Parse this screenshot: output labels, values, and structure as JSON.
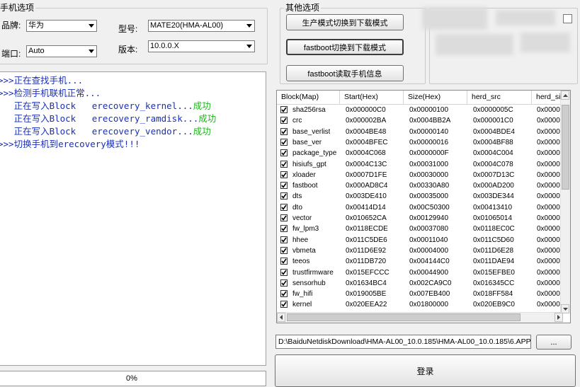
{
  "phone_options": {
    "title": "手机选项",
    "brand_label": "品牌:",
    "brand_value": "华为",
    "model_label": "型号:",
    "model_value": "MATE20(HMA-AL00)",
    "port_label": "端口:",
    "port_value": "Auto",
    "version_label": "版本:",
    "version_value": "10.0.0.X"
  },
  "other_options": {
    "title": "其他选项",
    "btn_download_mode": "生产模式切换到下载模式",
    "btn_fastboot_download": "fastboot切换到下载模式",
    "btn_fastboot_read": "fastboot读取手机信息"
  },
  "log": {
    "lines": [
      {
        "text": ">>>正在查找手机...",
        "suffix": ""
      },
      {
        "text": ">>>检测手机联机正常...",
        "suffix": ""
      },
      {
        "text": "   正在写入Block   erecovery_kernel...",
        "suffix": "成功"
      },
      {
        "text": "   正在写入Block   erecovery_ramdisk...",
        "suffix": "成功"
      },
      {
        "text": "   正在写入Block   erecovery_vendor...",
        "suffix": "成功"
      },
      {
        "text": ">>>切换手机到erecovery模式!!!",
        "suffix": ""
      }
    ]
  },
  "progress": {
    "text": "0%",
    "value": 0
  },
  "table": {
    "columns": [
      "Block(Map)",
      "Start(Hex)",
      "Size(Hex)",
      "herd_src",
      "herd_siz"
    ],
    "rows": [
      [
        "sha256rsa",
        "0x000000C0",
        "0x00000100",
        "0x0000005C",
        "0x00000"
      ],
      [
        "crc",
        "0x000002BA",
        "0x0004BB2A",
        "0x000001C0",
        "0x00000"
      ],
      [
        "base_verlist",
        "0x0004BE48",
        "0x00000140",
        "0x0004BDE4",
        "0x00000"
      ],
      [
        "base_ver",
        "0x0004BFEC",
        "0x00000016",
        "0x0004BF88",
        "0x00000"
      ],
      [
        "package_type",
        "0x0004C068",
        "0x0000000F",
        "0x0004C004",
        "0x00000"
      ],
      [
        "hisiufs_gpt",
        "0x0004C13C",
        "0x00031000",
        "0x0004C078",
        "0x00000"
      ],
      [
        "xloader",
        "0x0007D1FE",
        "0x00030000",
        "0x0007D13C",
        "0x00000"
      ],
      [
        "fastboot",
        "0x000AD8C4",
        "0x00330A80",
        "0x000AD200",
        "0x00000"
      ],
      [
        "dts",
        "0x003DE410",
        "0x00035000",
        "0x003DE344",
        "0x00000"
      ],
      [
        "dto",
        "0x00414D14",
        "0x00C50300",
        "0x00413410",
        "0x00000"
      ],
      [
        "vector",
        "0x010652CA",
        "0x00129940",
        "0x01065014",
        "0x00000"
      ],
      [
        "fw_lpm3",
        "0x0118ECDE",
        "0x00037080",
        "0x0118EC0C",
        "0x00000"
      ],
      [
        "hhee",
        "0x011C5DE6",
        "0x00011040",
        "0x011C5D60",
        "0x00000"
      ],
      [
        "vbmeta",
        "0x011D6E92",
        "0x00004000",
        "0x011D6E28",
        "0x00000"
      ],
      [
        "teeos",
        "0x011DB720",
        "0x004144C0",
        "0x011DAE94",
        "0x00000"
      ],
      [
        "trustfirmware",
        "0x015EFCCC",
        "0x00044900",
        "0x015EFBE0",
        "0x00000"
      ],
      [
        "sensorhub",
        "0x01634BC4",
        "0x002CA9C0",
        "0x016345CC",
        "0x00000"
      ],
      [
        "fw_hifi",
        "0x019005BE",
        "0x007EB400",
        "0x018FF584",
        "0x00000"
      ],
      [
        "kernel",
        "0x020EEA22",
        "0x01800000",
        "0x020EB9C0",
        "0x00000"
      ]
    ]
  },
  "file_path": "D:\\BaiduNetdiskDownload\\HMA-AL00_10.0.185\\HMA-AL00_10.0.185\\6.APP",
  "browse_label": "...",
  "login_label": "登录"
}
